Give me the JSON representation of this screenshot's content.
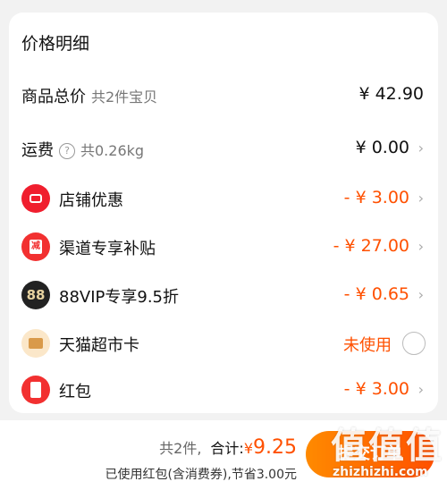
{
  "section_title": "价格明细",
  "rows": {
    "goods": {
      "label": "商品总价",
      "sub": "共2件宝贝",
      "value": "¥ 42.90"
    },
    "shipping": {
      "label": "运费",
      "help": "?",
      "sub": "共0.26kg",
      "value": "¥ 0.00"
    },
    "shop_discount": {
      "label": "店铺优惠",
      "value": "- ¥ 3.00",
      "icon": "ticket-icon"
    },
    "channel_subsidy": {
      "label": "渠道专享补贴",
      "value": "- ¥ 27.00",
      "icon": "subsidy-icon",
      "icon_text": "减"
    },
    "vip": {
      "label": "88VIP专享9.5折",
      "value": "- ¥ 0.65",
      "icon": "vip88-icon",
      "icon_text": "88"
    },
    "tmall_card": {
      "label": "天猫超市卡",
      "value": "未使用",
      "icon": "card-icon"
    },
    "red_packet": {
      "label": "红包",
      "value": "- ¥ 3.00",
      "icon": "red-packet-icon"
    }
  },
  "footer": {
    "count": "共2件,",
    "total_label": "合计:",
    "currency": "¥",
    "total_value": "9.25",
    "saving_text": "已使用红包(含消费券),节省3.00元",
    "submit_label": "提交订单",
    "watermark": "值值值",
    "watermark_sub": "zhizhizhi.com"
  },
  "colors": {
    "accent": "#ff5000",
    "brand_red": "#f23030"
  }
}
